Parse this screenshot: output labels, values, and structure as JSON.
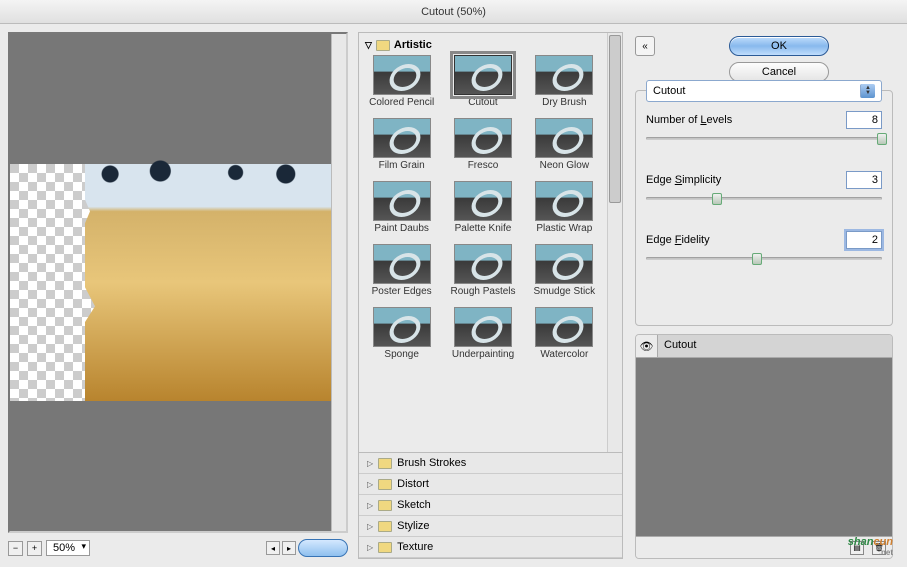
{
  "title": "Cutout (50%)",
  "zoom": "50%",
  "category": {
    "name": "Artistic"
  },
  "filters": [
    "Colored Pencil",
    "Cutout",
    "Dry Brush",
    "Film Grain",
    "Fresco",
    "Neon Glow",
    "Paint Daubs",
    "Palette Knife",
    "Plastic Wrap",
    "Poster Edges",
    "Rough Pastels",
    "Smudge Stick",
    "Sponge",
    "Underpainting",
    "Watercolor"
  ],
  "selected_filter": "Cutout",
  "accordion": [
    "Brush Strokes",
    "Distort",
    "Sketch",
    "Stylize",
    "Texture"
  ],
  "buttons": {
    "ok": "OK",
    "cancel": "Cancel"
  },
  "dropdown": "Cutout",
  "params": {
    "levels": {
      "label": "Number of Levels",
      "value": "8",
      "pos": 98
    },
    "simplicity": {
      "label": "Edge Simplicity",
      "value": "3",
      "pos": 28
    },
    "fidelity": {
      "label": "Edge Fidelity",
      "value": "2",
      "pos": 45
    }
  },
  "layer": {
    "name": "Cutout"
  },
  "watermark": {
    "a": "shan",
    "b": "cun",
    "c": ".net"
  }
}
